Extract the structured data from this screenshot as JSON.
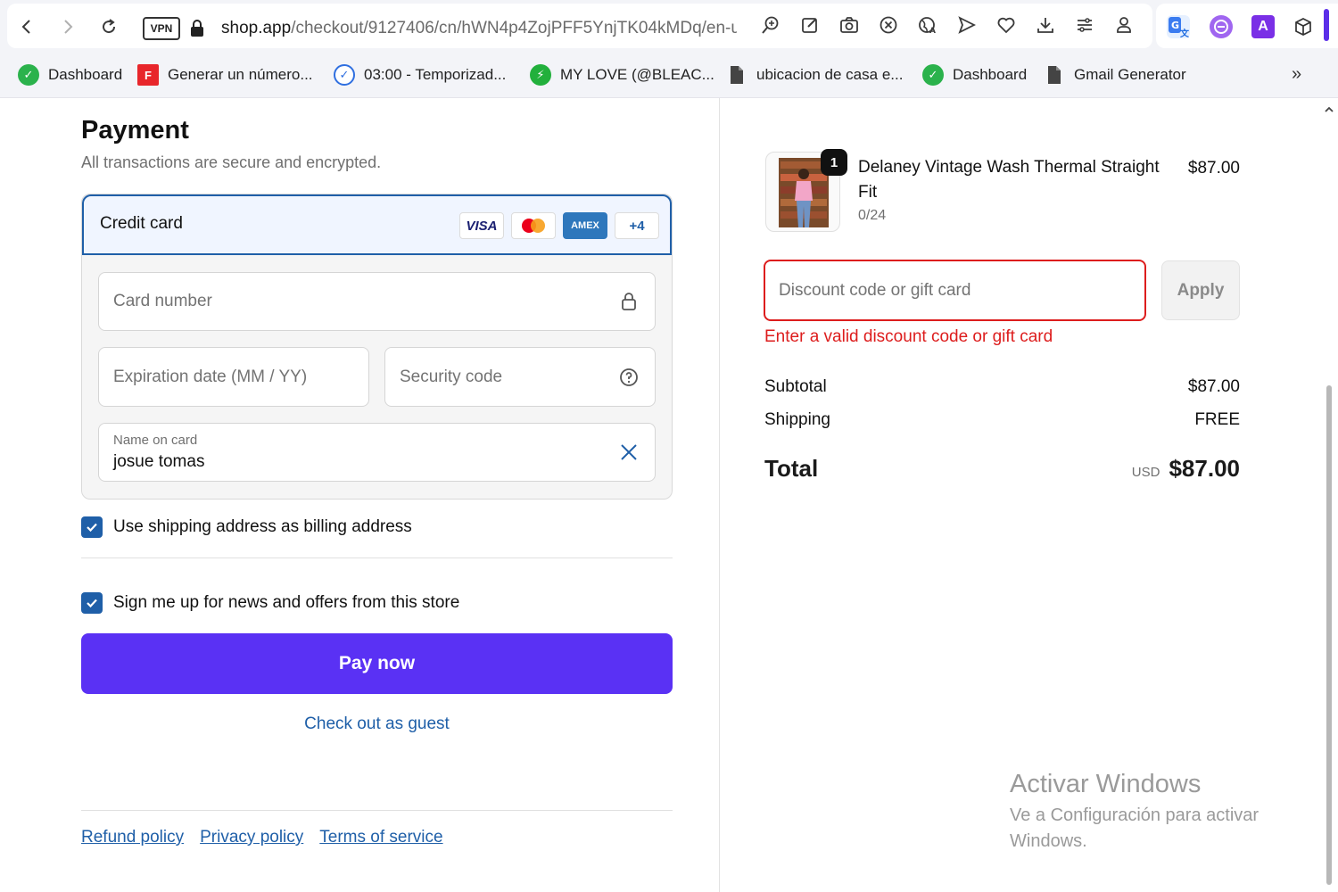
{
  "browser": {
    "vpn_label": "VPN",
    "url_host": "shop.app",
    "url_path": "/checkout/9127406/cn/hWN4p4ZojPFF5YnjTK04kMDq/en-u",
    "toolbar_icons": [
      "zoom-icon",
      "edit-icon",
      "camera-icon",
      "adblock-icon",
      "world-translate-icon",
      "send-icon",
      "heart-icon",
      "download-icon",
      "menu-icon",
      "profile-icon"
    ],
    "extensions": [
      "translate-extension-icon",
      "purple-extension-icon",
      "a-extension-icon",
      "cube-extension-icon"
    ],
    "extension_a_label": "A"
  },
  "bookmarks": [
    {
      "label": "Dashboard",
      "icon": "green-badge-icon",
      "color": "#2bb24c"
    },
    {
      "label": "Generar un número...",
      "icon": "red-f-icon",
      "color": "#e8262b",
      "glyph": "F"
    },
    {
      "label": "03:00 - Temporizad...",
      "icon": "timer-check-icon",
      "color": "#2f6fe0"
    },
    {
      "label": "MY LOVE (@BLEAC...",
      "icon": "bolt-icon",
      "color": "#22b03c"
    },
    {
      "label": "ubicacion de casa e...",
      "icon": "document-icon",
      "color": "#444444"
    },
    {
      "label": "Dashboard",
      "icon": "green-badge-icon",
      "color": "#2bb24c"
    },
    {
      "label": "Gmail Generator",
      "icon": "document-icon",
      "color": "#444444"
    }
  ],
  "payment": {
    "title": "Payment",
    "subtitle": "All transactions are secure and encrypted.",
    "method_label": "Credit card",
    "card_brands": [
      "VISA",
      "mastercard",
      "AMEX",
      "+4"
    ],
    "card_number_placeholder": "Card number",
    "expiration_placeholder": "Expiration date (MM / YY)",
    "security_placeholder": "Security code",
    "name_label": "Name on card",
    "name_value": "josue tomas",
    "billing_checkbox_label": "Use shipping address as billing address",
    "billing_checked": true,
    "newsletter_checkbox_label": "Sign me up for news and offers from this store",
    "newsletter_checked": true,
    "pay_button": "Pay now",
    "guest_link": "Check out as guest"
  },
  "footer": {
    "links": [
      "Refund policy",
      "Privacy policy",
      "Terms of service"
    ]
  },
  "order": {
    "product_name": "Delaney Vintage Wash Thermal Straight Fit",
    "product_variant": "0/24",
    "product_price": "$87.00",
    "quantity": "1",
    "discount_placeholder": "Discount code or gift card",
    "apply_button": "Apply",
    "discount_error": "Enter a valid discount code or gift card",
    "subtotal_label": "Subtotal",
    "subtotal_value": "$87.00",
    "shipping_label": "Shipping",
    "shipping_value": "FREE",
    "total_label": "Total",
    "currency": "USD",
    "total_value": "$87.00"
  },
  "watermark": {
    "title": "Activar Windows",
    "subtitle": "Ve a Configuración para activar Windows."
  },
  "colors": {
    "accent": "#5a31f4",
    "link": "#1f5fa8",
    "error": "#dd1d1d"
  }
}
